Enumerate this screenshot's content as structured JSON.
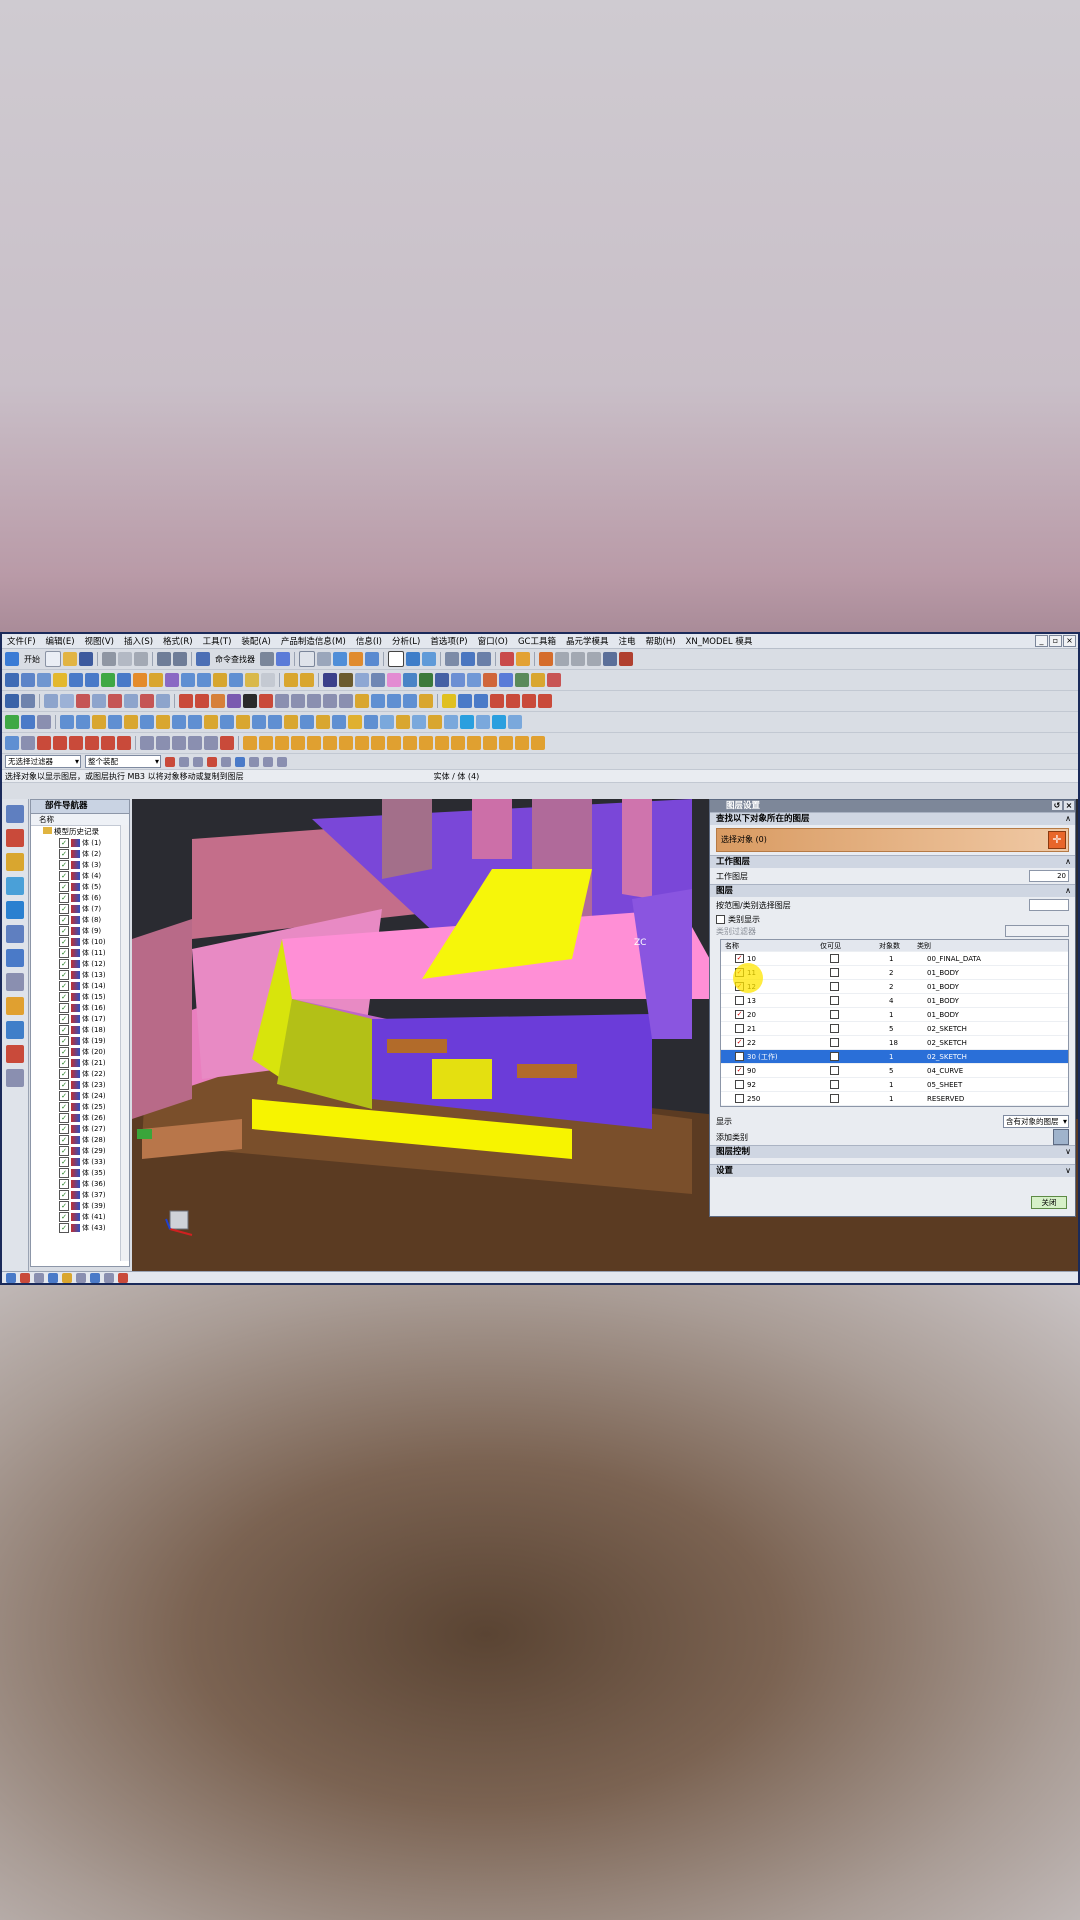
{
  "menu": [
    "文件(F)",
    "编辑(E)",
    "视图(V)",
    "插入(S)",
    "格式(R)",
    "工具(T)",
    "装配(A)",
    "产品制造信息(M)",
    "信息(I)",
    "分析(L)",
    "首选项(P)",
    "窗口(O)",
    "GC工具箱",
    "晶元学模具",
    "注电",
    "帮",
    "帮助(H)",
    "XN_MODEL 模具"
  ],
  "toolbar": {
    "start_label": "开始",
    "command_finder": "命令查找器"
  },
  "filter": {
    "type_filter": "无选择过滤器",
    "scope": "整个装配"
  },
  "cue": {
    "message": "选择对象以显示图层，或图层执行 MB3 以将对象移动或复制到图层",
    "selection": "实体 / 体 (4)"
  },
  "navigator": {
    "title": "部件导航器",
    "col_name": "名称",
    "history": "模型历史记录",
    "features": [
      "体 (1)",
      "体 (2)",
      "体 (3)",
      "体 (4)",
      "体 (5)",
      "体 (6)",
      "体 (7)",
      "体 (8)",
      "体 (9)",
      "体 (10)",
      "体 (11)",
      "体 (12)",
      "体 (13)",
      "体 (14)",
      "体 (15)",
      "体 (16)",
      "体 (17)",
      "体 (18)",
      "体 (19)",
      "体 (20)",
      "体 (21)",
      "体 (22)",
      "体 (23)",
      "体 (24)",
      "体 (25)",
      "体 (26)",
      "体 (27)",
      "体 (28)",
      "体 (29)",
      "体 (33)",
      "体 (35)",
      "体 (36)",
      "体 (37)",
      "体 (39)",
      "体 (41)",
      "体 (43)"
    ]
  },
  "dialog": {
    "title": "图层设置",
    "sec_find": "查找以下对象所在的图层",
    "select_object": "选择对象 (0)",
    "sec_work": "工作图层",
    "work_layer_label": "工作图层",
    "work_layer_value": "20",
    "sec_layers": "图层",
    "by_range": "按范围/类别选择图层",
    "category_display": "类别显示",
    "cat_filter": "类别过滤器",
    "col_name": "名称",
    "col_visible": "仅可见",
    "col_count": "对象数",
    "col_category": "类别",
    "rows": [
      {
        "name": "10",
        "checked": true,
        "count": "1",
        "category": "00_FINAL_DATA"
      },
      {
        "name": "11",
        "checked": true,
        "count": "2",
        "category": "01_BODY"
      },
      {
        "name": "12",
        "checked": true,
        "count": "2",
        "category": "01_BODY"
      },
      {
        "name": "13",
        "checked": false,
        "count": "4",
        "category": "01_BODY"
      },
      {
        "name": "20",
        "checked": true,
        "count": "1",
        "category": "01_BODY"
      },
      {
        "name": "21",
        "checked": false,
        "count": "5",
        "category": "02_SKETCH"
      },
      {
        "name": "22",
        "checked": true,
        "count": "18",
        "category": "02_SKETCH"
      },
      {
        "name": "30 (工作)",
        "checked": false,
        "count": "1",
        "category": "02_SKETCH",
        "selected": true
      },
      {
        "name": "90",
        "checked": true,
        "count": "5",
        "category": "04_CURVE"
      },
      {
        "name": "92",
        "checked": false,
        "count": "1",
        "category": "05_SHEET"
      },
      {
        "name": "250",
        "checked": false,
        "count": "1",
        "category": "RESERVED"
      }
    ],
    "display_label": "显示",
    "display_value": "含有对象的图层",
    "add_category": "添加类别",
    "sec_layer_control": "图层控制",
    "sec_settings": "设置",
    "close": "关闭"
  },
  "viewport": {
    "axis_label": "ZC"
  }
}
